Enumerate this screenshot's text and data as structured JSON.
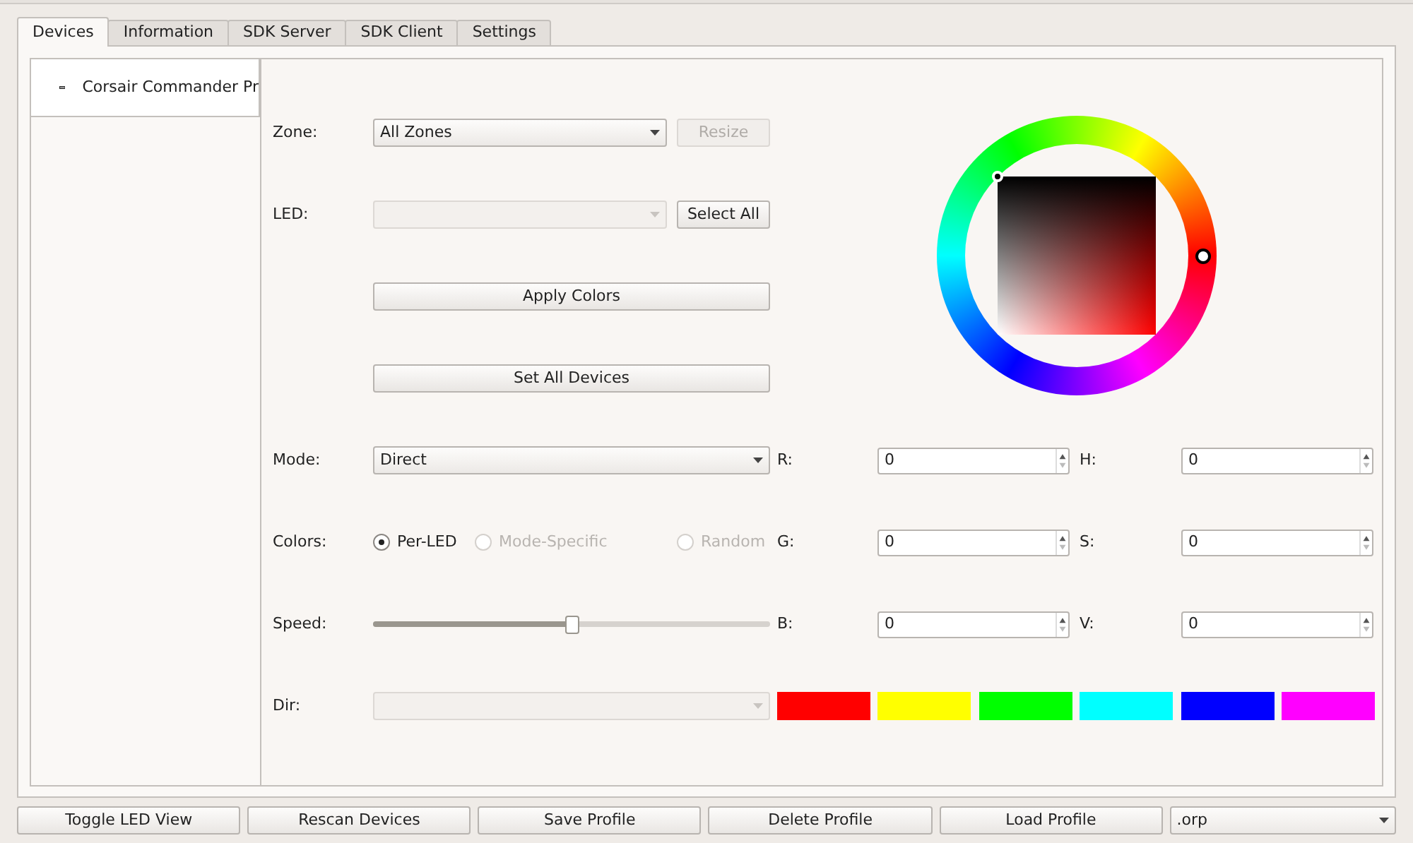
{
  "tabs": [
    {
      "label": "Devices",
      "selected": true
    },
    {
      "label": "Information",
      "selected": false
    },
    {
      "label": "SDK Server",
      "selected": false
    },
    {
      "label": "SDK Client",
      "selected": false
    },
    {
      "label": "Settings",
      "selected": false
    }
  ],
  "devices": [
    {
      "name": "Corsair Commander Pr",
      "selected": true
    }
  ],
  "zone": {
    "label": "Zone:",
    "value": "All Zones",
    "button": "Resize",
    "button_disabled": true
  },
  "led": {
    "label": "LED:",
    "disabled": true,
    "button": "Select All",
    "button_disabled": false
  },
  "apply_button": "Apply Colors",
  "set_all_button": "Set All Devices",
  "mode": {
    "label": "Mode:",
    "value": "Direct"
  },
  "colors": {
    "label": "Colors:",
    "options": [
      {
        "label": "Per-LED",
        "selected": true,
        "disabled": false
      },
      {
        "label": "Mode-Specific",
        "selected": false,
        "disabled": true
      },
      {
        "label": "Random",
        "selected": false,
        "disabled": true
      }
    ]
  },
  "speed": {
    "label": "Speed:",
    "level": 0.5
  },
  "dir": {
    "label": "Dir:",
    "disabled": true
  },
  "rgb": [
    {
      "label": "R:",
      "value": "0"
    },
    {
      "label": "G:",
      "value": "0"
    },
    {
      "label": "B:",
      "value": "0"
    }
  ],
  "hsv": [
    {
      "label": "H:",
      "value": "0"
    },
    {
      "label": "S:",
      "value": "0"
    },
    {
      "label": "V:",
      "value": "0"
    }
  ],
  "swatches": [
    {
      "color": "#ff0000"
    },
    {
      "color": "#ffff00"
    },
    {
      "color": "#00ff00"
    },
    {
      "color": "#00ffff"
    },
    {
      "color": "#0000ff"
    },
    {
      "color": "#ff00ff"
    }
  ],
  "bottom_buttons": [
    "Toggle LED View",
    "Rescan Devices",
    "Save Profile",
    "Delete Profile",
    "Load Profile"
  ],
  "profile_combo": {
    "value": ".orp"
  }
}
